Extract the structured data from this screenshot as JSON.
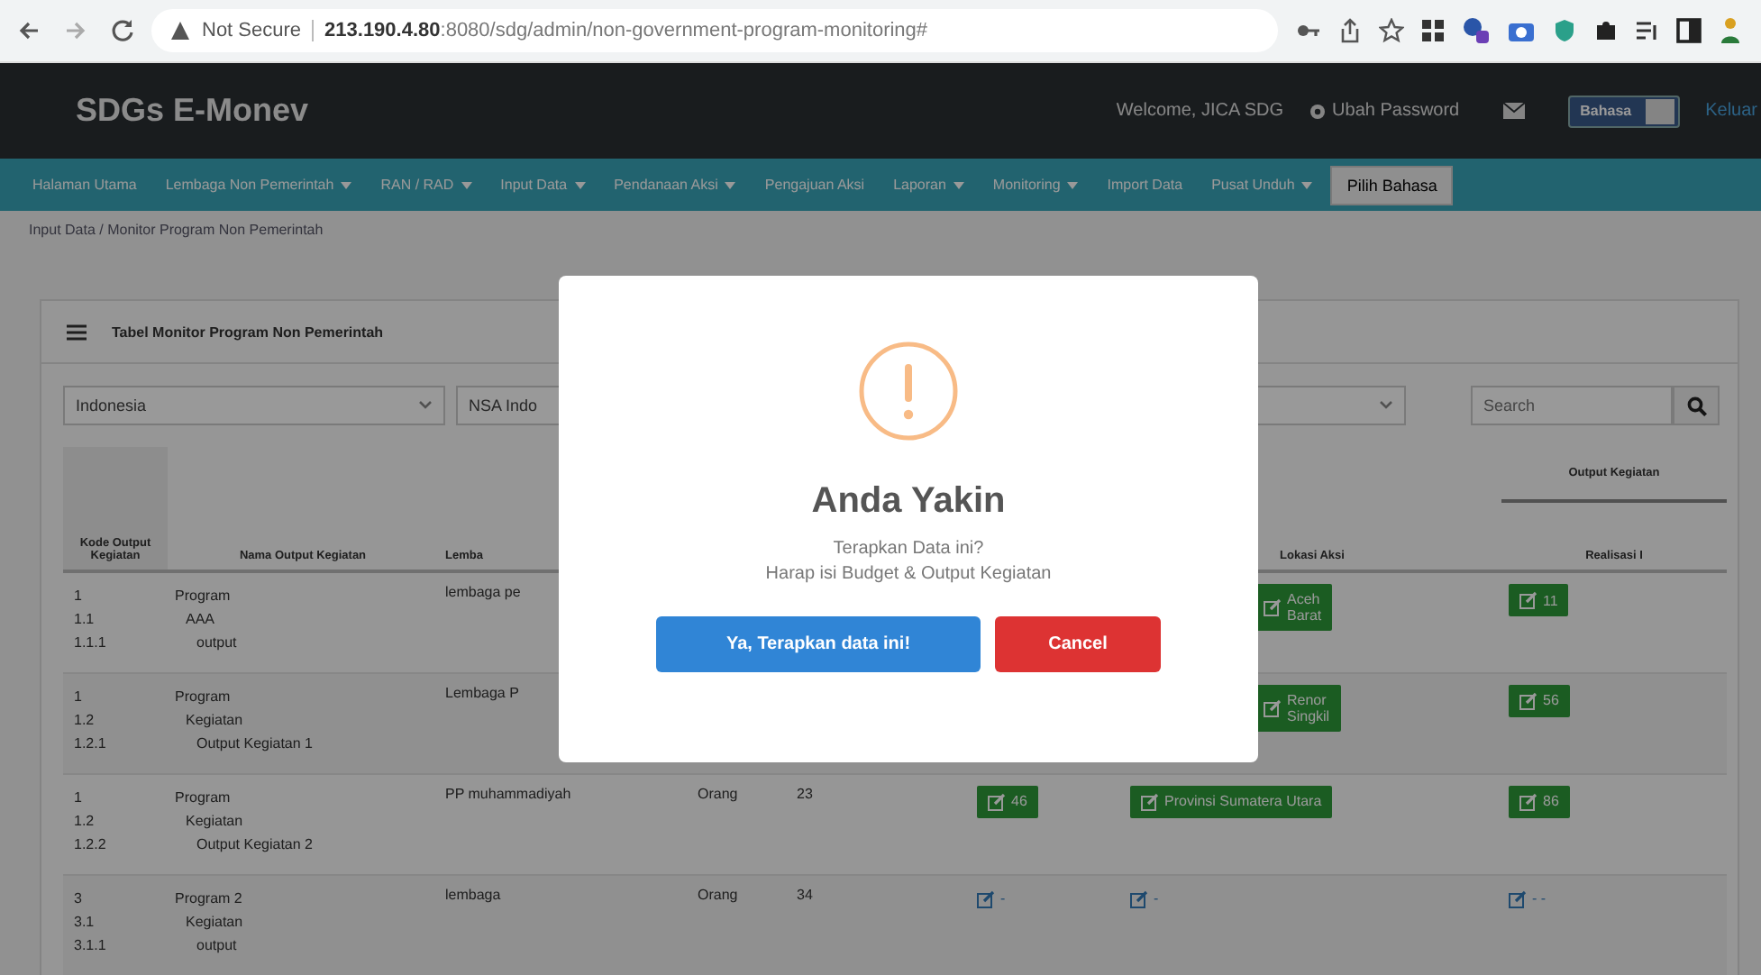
{
  "browser": {
    "security": "Not Secure",
    "url_host": "213.190.4.80",
    "url_path": ":8080/sdg/admin/non-government-program-monitoring#"
  },
  "header": {
    "brand": "SDGs E-Monev",
    "welcome": "Welcome, JICA SDG",
    "change_password": "Ubah Password",
    "language_toggle": {
      "label": "Bahasa",
      "on": false
    },
    "logout": "Keluar"
  },
  "nav": {
    "items": [
      {
        "label": "Halaman Utama",
        "has_menu": false
      },
      {
        "label": "Lembaga Non Pemerintah",
        "has_menu": true
      },
      {
        "label": "RAN / RAD",
        "has_menu": true
      },
      {
        "label": "Input Data",
        "has_menu": true
      },
      {
        "label": "Pendanaan Aksi",
        "has_menu": true
      },
      {
        "label": "Pengajuan Aksi",
        "has_menu": false
      },
      {
        "label": "Laporan",
        "has_menu": true
      },
      {
        "label": "Monitoring",
        "has_menu": true
      },
      {
        "label": "Import Data",
        "has_menu": false
      },
      {
        "label": "Pusat Unduh",
        "has_menu": true
      }
    ],
    "language_button": "Pilih Bahasa"
  },
  "breadcrumb": "Input Data / Monitor Program Non Pemerintah",
  "card": {
    "title": "Tabel Monitor Program Non Pemerintah"
  },
  "filters": [
    {
      "kind": "select",
      "value": "Indonesia",
      "cut": false
    },
    {
      "kind": "select",
      "value": "NSA Indo",
      "cut": true
    },
    {
      "kind": "select",
      "cut": false
    }
  ],
  "search": {
    "placeholder": "Search"
  },
  "table": {
    "columns": [
      {
        "label": "Kode Output Kegiatan"
      },
      {
        "label": "Nama Output Kegiatan"
      },
      {
        "label": "Lemba"
      },
      {},
      {},
      {},
      {
        "label": "Lokasi Aksi"
      },
      {
        "label": "Realisasi I",
        "group": "Output Kegiatan"
      }
    ],
    "rows": [
      {
        "codes": [
          "1",
          "1.1",
          "1.1.1"
        ],
        "names": [
          "Program",
          "AAA",
          "output"
        ],
        "lembaga": "lembaga pe",
        "cut": true,
        "lokasi": {
          "kind": "filled",
          "lines": [
            "Aceh",
            "Barat"
          ]
        },
        "realisasi": {
          "kind": "filled",
          "text": "11"
        }
      },
      {
        "codes": [
          "1",
          "1.2",
          "1.2.1"
        ],
        "names": [
          "Program",
          "Kegiatan",
          "Output Kegiatan 1"
        ],
        "lembaga": "Lembaga P",
        "cut": true,
        "lokasi": {
          "kind": "filled",
          "lines": [
            "Renor",
            "Singkil"
          ]
        },
        "realisasi": {
          "kind": "filled",
          "text": "56"
        }
      },
      {
        "codes": [
          "1",
          "1.2",
          "1.2.2"
        ],
        "names": [
          "Program",
          "Kegiatan",
          "Output Kegiatan 2"
        ],
        "lembaga": "PP muhammadiyah",
        "cut": false,
        "satuan": "Orang",
        "target": "23",
        "budget": {
          "kind": "filled",
          "text": "46"
        },
        "lokasi": {
          "kind": "filled",
          "lines": [
            "Provinsi Sumatera Utara"
          ]
        },
        "realisasi": {
          "kind": "filled",
          "text": "86"
        }
      },
      {
        "codes": [
          "3",
          "3.1",
          "3.1.1"
        ],
        "names": [
          "Program 2",
          "Kegiatan",
          "output"
        ],
        "lembaga": "lembaga",
        "cut": false,
        "satuan": "Orang",
        "target": "34",
        "budget": {
          "kind": "link",
          "text": "-"
        },
        "lokasi": {
          "kind": "link",
          "lines": [
            "-"
          ]
        },
        "realisasi": {
          "kind": "link",
          "text": "- -"
        }
      }
    ]
  },
  "dialog": {
    "title": "Anda Yakin",
    "message": [
      "Terapkan Data ini?",
      "Harap isi Budget & Output Kegiatan"
    ],
    "buttons": [
      {
        "label": "Ya, Terapkan data ini!",
        "kind": "confirm"
      },
      {
        "label": "Cancel",
        "kind": "cancel"
      }
    ]
  }
}
